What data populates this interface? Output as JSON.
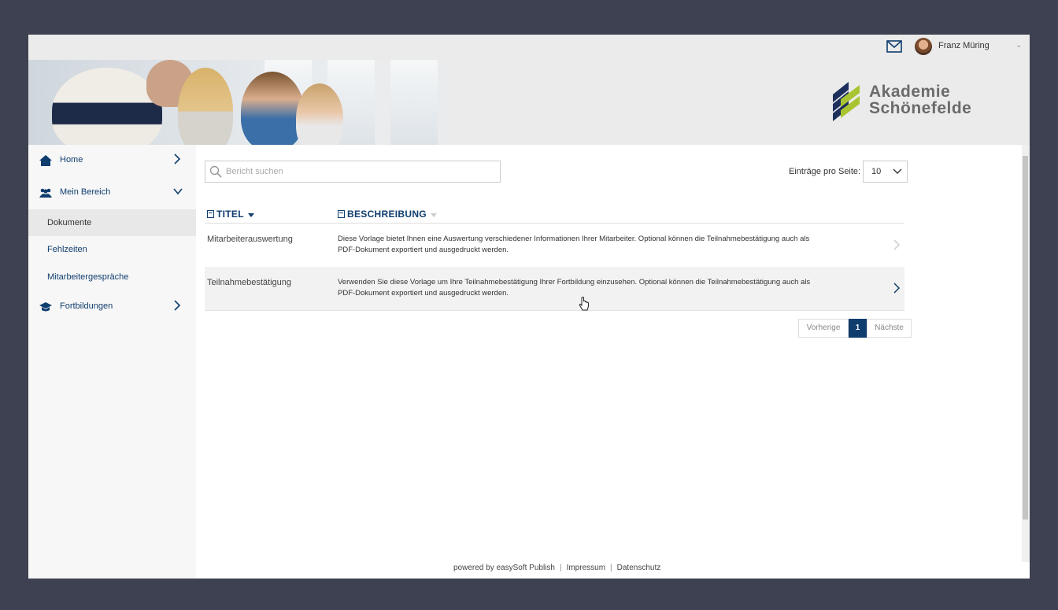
{
  "header": {
    "user_name": "Franz Müring",
    "logo_line1": "Akademie",
    "logo_line2": "Schönefelde"
  },
  "sidebar": {
    "items": [
      {
        "label": "Home",
        "icon": "home-icon"
      },
      {
        "label": "Mein Bereich",
        "icon": "people-icon"
      },
      {
        "label": "Dokumente"
      },
      {
        "label": "Fehlzeiten"
      },
      {
        "label": "Mitarbeitergespräche"
      },
      {
        "label": "Fortbildungen",
        "icon": "graduation-cap-icon"
      }
    ]
  },
  "main": {
    "search_placeholder": "Bericht suchen",
    "entries_label": "Einträge pro Seite:",
    "entries_value": "10",
    "columns": [
      "TITEL",
      "BESCHREIBUNG"
    ],
    "rows": [
      {
        "title": "Mitarbeiterauswertung",
        "description": "Diese Vorlage bietet Ihnen eine Auswertung verschiedener Informationen Ihrer Mitarbeiter. Optional können die Teilnahmebestätigung auch als PDF-Dokument exportiert und ausgedruckt werden."
      },
      {
        "title": "Teilnahmebestätigung",
        "description": "Verwenden Sie diese Vorlage um Ihre Teilnahmebestätigung Ihrer Fortbildung einzusehen. Optional können die Teilnahmebestätigung auch als PDF-Dokument exportiert und ausgedruckt werden."
      }
    ],
    "pagination": {
      "prev": "Vorherige",
      "page": "1",
      "next": "Nächste"
    }
  },
  "footer": {
    "powered": "powered by easySoft Publish",
    "impressum": "Impressum",
    "datenschutz": "Datenschutz"
  },
  "colors": {
    "primary": "#0f3d6e",
    "accent_green": "#a8c531",
    "background": "#3d4151"
  }
}
